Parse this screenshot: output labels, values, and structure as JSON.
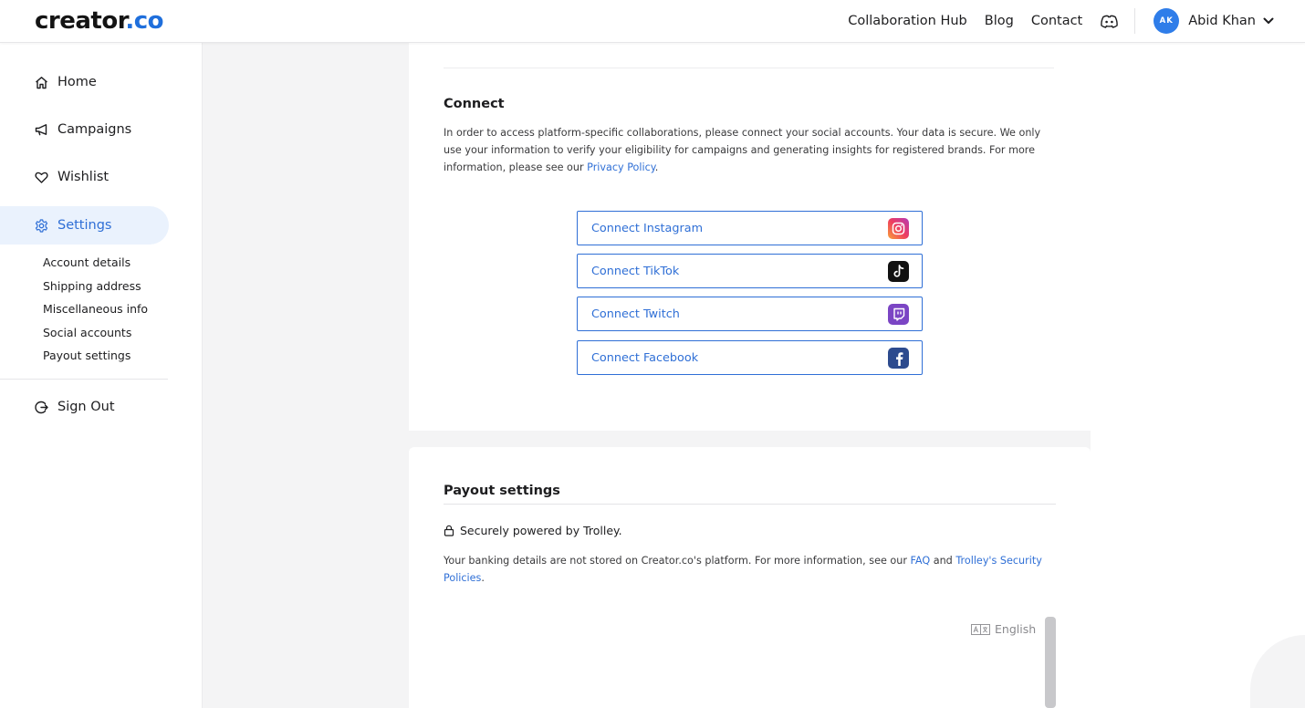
{
  "brand": {
    "logo_prefix": "cre",
    "logo_a": "a",
    "logo_mid": "tor",
    "logo_suffix": ".co"
  },
  "header": {
    "nav": [
      "Collaboration Hub",
      "Blog",
      "Contact"
    ],
    "discord_icon": "discord-icon",
    "user": {
      "initials": "AK",
      "name": "Abid Khan"
    }
  },
  "sidebar": {
    "items": [
      {
        "label": "Home",
        "icon": "home-icon"
      },
      {
        "label": "Campaigns",
        "icon": "megaphone-icon"
      },
      {
        "label": "Wishlist",
        "icon": "heart-icon"
      },
      {
        "label": "Settings",
        "icon": "gear-icon",
        "active": true
      }
    ],
    "sub_items": [
      "Account details",
      "Shipping address",
      "Miscellaneous info",
      "Social accounts",
      "Payout settings"
    ],
    "sign_out": "Sign Out"
  },
  "connect": {
    "title": "Connect",
    "text": "In order to access platform-specific collaborations, please connect your social accounts. Your data is secure. We only use your information to verify your eligibility for campaigns and generating insights for registered brands. For more information, please see our ",
    "privacy_link": "Privacy Policy",
    "text_end": ".",
    "buttons": [
      {
        "label": "Connect Instagram",
        "icon": "instagram-icon"
      },
      {
        "label": "Connect TikTok",
        "icon": "tiktok-icon"
      },
      {
        "label": "Connect Twitch",
        "icon": "twitch-icon"
      },
      {
        "label": "Connect Facebook",
        "icon": "facebook-icon"
      }
    ]
  },
  "payout": {
    "title": "Payout settings",
    "secure_text": "Securely powered by Trolley.",
    "text": "Your banking details are not stored on Creator.co's platform. For more information, see our ",
    "faq_link": "FAQ",
    "and": " and ",
    "trolley_link": "Trolley's Security Policies",
    "text_end": ".",
    "language": "English"
  },
  "colors": {
    "accent": "#2f6fd6",
    "active_bg": "#eaf2fd"
  }
}
